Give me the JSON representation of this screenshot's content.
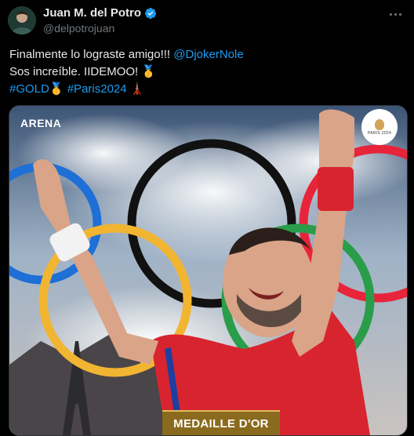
{
  "author": {
    "name": "Juan M. del Potro",
    "handle": "@delpotrojuan"
  },
  "post": {
    "line1_text": "Finalmente lo lograste amigo!!! ",
    "line1_mention": "@DjokerNole",
    "line2_text": "Sos increíble. IIDEMOO! ",
    "line2_emoji": "🥇",
    "hashtag1": "#GOLD",
    "hashtag1_emoji": "🥇",
    "hashtag2": "#Paris2024",
    "hashtag2_emoji": "🗼"
  },
  "media": {
    "corner_text": "ARENA",
    "logo_text": "PARIS 2024",
    "banner_text": "MEDAILLE D'OR"
  },
  "colors": {
    "accent": "#1d9bf0",
    "ring_blue": "#1e6fd6",
    "ring_yellow": "#f2b532",
    "ring_black": "#111111",
    "ring_green": "#2a9d4a",
    "ring_red": "#e8243a"
  },
  "icons": [
    "verified-badge-icon",
    "more-options-icon",
    "gold-medal-emoji",
    "eiffel-tower-emoji"
  ]
}
